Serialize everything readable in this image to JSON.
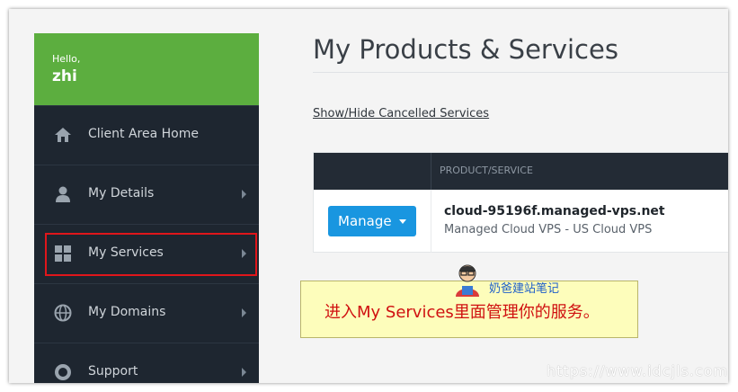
{
  "sidebar": {
    "greeting": "Hello,",
    "username": "zhi",
    "items": [
      {
        "label": "Client Area Home",
        "icon": "home-icon"
      },
      {
        "label": "My Details",
        "icon": "user-icon"
      },
      {
        "label": "My Services",
        "icon": "grid-icon"
      },
      {
        "label": "My Domains",
        "icon": "globe-icon"
      },
      {
        "label": "Support",
        "icon": "lifebuoy-icon"
      }
    ]
  },
  "main": {
    "title": "My Products & Services",
    "toggle_link": "Show/Hide Cancelled Services",
    "table": {
      "header": "PRODUCT/SERVICE",
      "rows": [
        {
          "action": "Manage",
          "name": "cloud-95196f.managed-vps.net",
          "description": "Managed Cloud VPS - US Cloud VPS"
        }
      ]
    }
  },
  "annotation": {
    "brand": "奶爸建站笔记",
    "text": "进入My Services里面管理你的服务。"
  },
  "watermark": "https://www.idcjls.com",
  "colors": {
    "accent_green": "#5cae3f",
    "sidebar_bg": "#1e2630",
    "manage_blue": "#1996e0",
    "highlight_red": "#e0161b"
  }
}
